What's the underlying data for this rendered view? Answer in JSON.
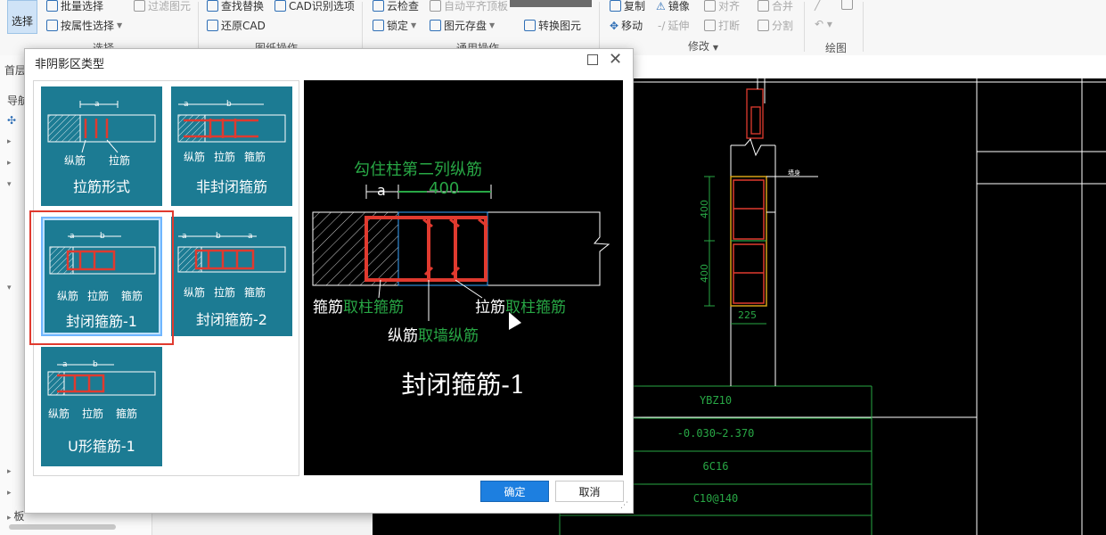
{
  "ribbon": {
    "select": "选择",
    "batch_select": "批量选择",
    "filter_elements": "过滤图元",
    "select_by_attribute": "按属性选择",
    "find_replace": "查找替换",
    "cad_recognize_options": "CAD识别选项",
    "restore_cad": "还原CAD",
    "cloud_check": "云检查",
    "auto_align_top": "自动平齐顶板",
    "lock": "锁定",
    "element_save": "图元存盘",
    "convert_element": "转换图元",
    "copy": "复制",
    "mirror": "镜像",
    "align": "对齐",
    "merge": "合并",
    "move": "移动",
    "extend": "延伸",
    "break": "打断",
    "split": "分割",
    "group_select": "选择",
    "group_drawing_ops": "图纸操作",
    "group_general_ops": "通用操作",
    "group_modify": "修改",
    "group_draw": "绘图"
  },
  "left": {
    "tab_home": "首层",
    "nav": "导航",
    "item_plate": "板"
  },
  "dialog": {
    "title": "非阴影区类型",
    "tiles": [
      {
        "label": "拉筋形式",
        "sub": [
          "纵筋",
          "拉筋"
        ],
        "dim": "a"
      },
      {
        "label": "非封闭箍筋",
        "sub": [
          "纵筋",
          "拉筋",
          "箍筋"
        ],
        "dim": "a b"
      },
      {
        "label": "封闭箍筋-1",
        "sub": [
          "纵筋",
          "拉筋",
          "箍筋"
        ],
        "dim": "a b"
      },
      {
        "label": "封闭箍筋-2",
        "sub": [
          "纵筋",
          "拉筋",
          "箍筋"
        ],
        "dim": "a b a"
      },
      {
        "label": "U形箍筋-1",
        "sub": [
          "纵筋",
          "拉筋",
          "箍筋"
        ],
        "dim": "a b"
      }
    ],
    "preview": {
      "top_note": "勾住柱第二列纵筋",
      "dim_a": "a",
      "dim_400": "400",
      "stirrup": "箍筋",
      "stirrup_note": "取柱箍筋",
      "tie": "拉筋",
      "tie_note": "取柱箍筋",
      "long": "纵筋",
      "long_note": "取墙纵筋",
      "title": "封闭箍筋-1"
    },
    "ok": "确定",
    "cancel": "取消"
  },
  "cad": {
    "dim_400_a": "400",
    "dim_400_b": "400",
    "dim_225": "225",
    "rows": [
      "YBZ10",
      "-0.030~2.370",
      "6C16",
      "C10@140"
    ]
  }
}
